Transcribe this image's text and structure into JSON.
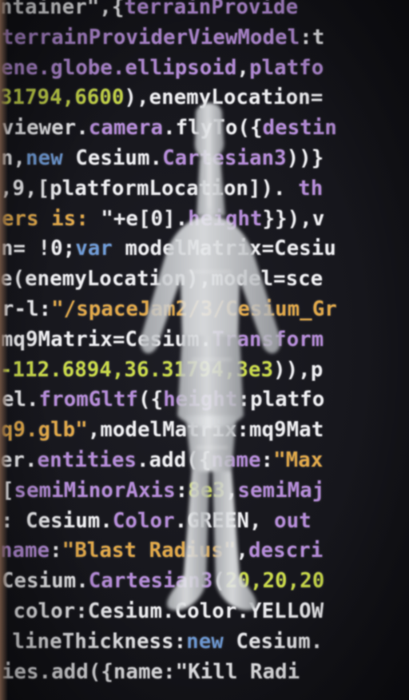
{
  "photo": {
    "subject": "photo-of-code-printed-on-surface",
    "palette": {
      "default": "#ededf0",
      "property": "#b58cd8",
      "keyword": "#6f9bd6",
      "number": "#c8d84a",
      "string": "#e0a84a",
      "background": "#141418"
    }
  },
  "code_lines": [
    [
      [
        "ntainer\",{",
        "default"
      ],
      [
        "terrainProvide",
        "property"
      ]
    ],
    [
      [
        "terrainProviderViewModel",
        "property"
      ],
      [
        ":t",
        "default"
      ]
    ],
    [
      [
        "ene.globe.ellipsoid",
        "property"
      ],
      [
        ",",
        "default"
      ],
      [
        "platfo",
        "property"
      ]
    ],
    [
      [
        "31794,6600",
        "number"
      ],
      [
        "),enemyLocation=",
        "default"
      ]
    ],
    [
      [
        "viewer.",
        "default"
      ],
      [
        "camera",
        "property"
      ],
      [
        ".flyTo({",
        "default"
      ],
      [
        "destin",
        "property"
      ]
    ],
    [
      [
        "n,",
        "default"
      ],
      [
        "new",
        "keyword"
      ],
      [
        " Cesium.",
        "default"
      ],
      [
        "Cartesian3",
        "property"
      ],
      [
        "))}",
        "default"
      ]
    ],
    [
      [
        ",9,[platformLocation]). ",
        "default"
      ],
      [
        "th",
        "property"
      ]
    ],
    [
      [
        "ers is: ",
        "string"
      ],
      [
        "\"+e[0].",
        "default"
      ],
      [
        "height",
        "property"
      ],
      [
        "}}),v",
        "default"
      ]
    ],
    [
      [
        "n= !0;",
        "default"
      ],
      [
        "var",
        "keyword"
      ],
      [
        " modelMatrix=Cesiu",
        "default"
      ]
    ],
    [
      [
        "e(enemyLocation),model=sce",
        "default"
      ]
    ],
    [
      [
        "r-l:",
        "default"
      ],
      [
        "\"/spaceJam2/3/Cesium_Gr",
        "string"
      ]
    ],
    [
      [
        "mq9Matrix=Cesium.",
        "default"
      ],
      [
        "Transform",
        "property"
      ]
    ],
    [
      [
        "-112.6894,36.31794,3e3",
        "number"
      ],
      [
        ")),p",
        "default"
      ]
    ],
    [
      [
        "el.",
        "default"
      ],
      [
        "fromGltf",
        "property"
      ],
      [
        "({",
        "default"
      ],
      [
        "height",
        "property"
      ],
      [
        ":platfo",
        "default"
      ]
    ],
    [
      [
        "q9.glb\"",
        "string"
      ],
      [
        ",modelMatrix:mq9Mat",
        "default"
      ]
    ],
    [
      [
        "er.",
        "default"
      ],
      [
        "entities",
        "property"
      ],
      [
        ".add({",
        "default"
      ],
      [
        "name",
        "property"
      ],
      [
        ":",
        "default"
      ],
      [
        "\"Max",
        "string"
      ]
    ],
    [
      [
        "[",
        "default"
      ],
      [
        "semiMinorAxis",
        "property"
      ],
      [
        ":",
        "default"
      ],
      [
        "8e3",
        "number"
      ],
      [
        ",",
        "default"
      ],
      [
        "semiMaj",
        "property"
      ]
    ],
    [
      [
        ": Cesium.",
        "default"
      ],
      [
        "Color",
        "property"
      ],
      [
        ".GREEN, ",
        "default"
      ],
      [
        "out",
        "property"
      ]
    ],
    [
      [
        "name",
        "property"
      ],
      [
        ":",
        "default"
      ],
      [
        "\"Blast Radius\"",
        "string"
      ],
      [
        ",",
        "default"
      ],
      [
        "descri",
        "property"
      ]
    ],
    [
      [
        "Cesium.",
        "default"
      ],
      [
        "Cartesian3",
        "property"
      ],
      [
        "(",
        "default"
      ],
      [
        "20,20,20",
        "number"
      ]
    ],
    [
      [
        " color:Cesium.Color.YELLOW",
        "default"
      ]
    ],
    [
      [
        " lineThickness:",
        "default"
      ],
      [
        "new",
        "keyword"
      ],
      [
        " Cesium.",
        "default"
      ]
    ],
    [
      [
        "ies.add({name:\"Kill Radi",
        "default"
      ]
    ]
  ]
}
